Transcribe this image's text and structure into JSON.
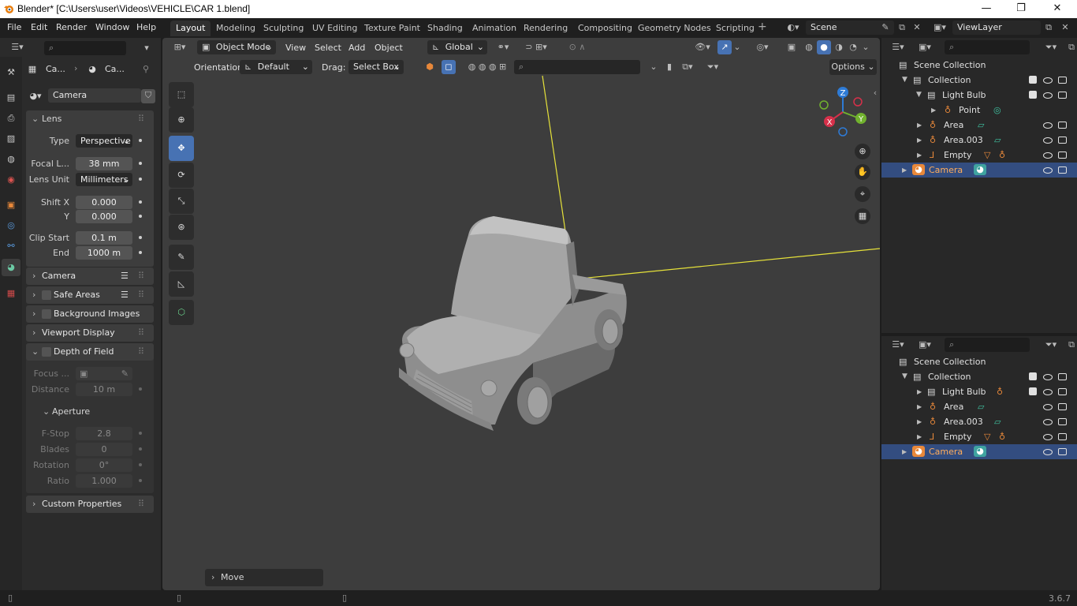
{
  "window": {
    "title": "Blender* [C:\\Users\\user\\Videos\\VEHICLE\\CAR 1.blend]",
    "minimize": "—",
    "maximize": "❐",
    "close": "✕"
  },
  "menubar": {
    "items": [
      "File",
      "Edit",
      "Render",
      "Window",
      "Help"
    ]
  },
  "workspaces": {
    "tabs": [
      "Layout",
      "Modeling",
      "Sculpting",
      "UV Editing",
      "Texture Paint",
      "Shading",
      "Animation",
      "Rendering",
      "Compositing",
      "Geometry Nodes",
      "Scripting"
    ],
    "active": "Layout",
    "add": "+"
  },
  "scene": {
    "name": "Scene"
  },
  "viewlayer": {
    "name": "ViewLayer"
  },
  "properties": {
    "breadcrumb": [
      "Ca...",
      "Ca..."
    ],
    "datablock": "Camera",
    "lens": {
      "header": "Lens",
      "type_label": "Type",
      "type_value": "Perspective",
      "focal_label": "Focal L...",
      "focal_value": "38 mm",
      "unit_label": "Lens Unit",
      "unit_value": "Millimeters",
      "shiftx_label": "Shift X",
      "shiftx_value": "0.000",
      "y_label": "Y",
      "y_value": "0.000",
      "clipstart_label": "Clip Start",
      "clipstart_value": "0.1 m",
      "end_label": "End",
      "end_value": "1000 m"
    },
    "sections": {
      "camera": "Camera",
      "safe_areas": "Safe Areas",
      "background_images": "Background Images",
      "viewport_display": "Viewport Display",
      "depth_of_field": "Depth of Field",
      "custom_properties": "Custom Properties"
    },
    "dof": {
      "focus_label": "Focus ...",
      "distance_label": "Distance",
      "distance_value": "10 m",
      "aperture": "Aperture",
      "fstop_label": "F-Stop",
      "fstop_value": "2.8",
      "blades_label": "Blades",
      "blades_value": "0",
      "rotation_label": "Rotation",
      "rotation_value": "0°",
      "ratio_label": "Ratio",
      "ratio_value": "1.000"
    }
  },
  "viewport": {
    "mode": "Object Mode",
    "menus": [
      "View",
      "Select",
      "Add",
      "Object"
    ],
    "transform": "Global",
    "orientation_label": "Orientation:",
    "orientation_value": "Default",
    "drag_label": "Drag:",
    "drag_value": "Select Box",
    "options": "Options",
    "last_op": "Move",
    "gizmo": {
      "x": "X",
      "y": "Y",
      "z": "Z"
    }
  },
  "outliner_top": {
    "rows": [
      {
        "label": "Scene Collection"
      },
      {
        "label": "Collection"
      },
      {
        "label": "Light Bulb"
      },
      {
        "label": "Point"
      },
      {
        "label": "Area"
      },
      {
        "label": "Area.003"
      },
      {
        "label": "Empty"
      },
      {
        "label": "Camera"
      }
    ]
  },
  "outliner_bottom": {
    "rows": [
      {
        "label": "Scene Collection"
      },
      {
        "label": "Collection"
      },
      {
        "label": "Light Bulb"
      },
      {
        "label": "Area"
      },
      {
        "label": "Area.003"
      },
      {
        "label": "Empty"
      },
      {
        "label": "Camera"
      }
    ]
  },
  "status": {
    "version": "3.6.7"
  },
  "colors": {
    "accent": "#4772b3",
    "selection": "#334d80",
    "camera_line": "#e6e23a"
  }
}
